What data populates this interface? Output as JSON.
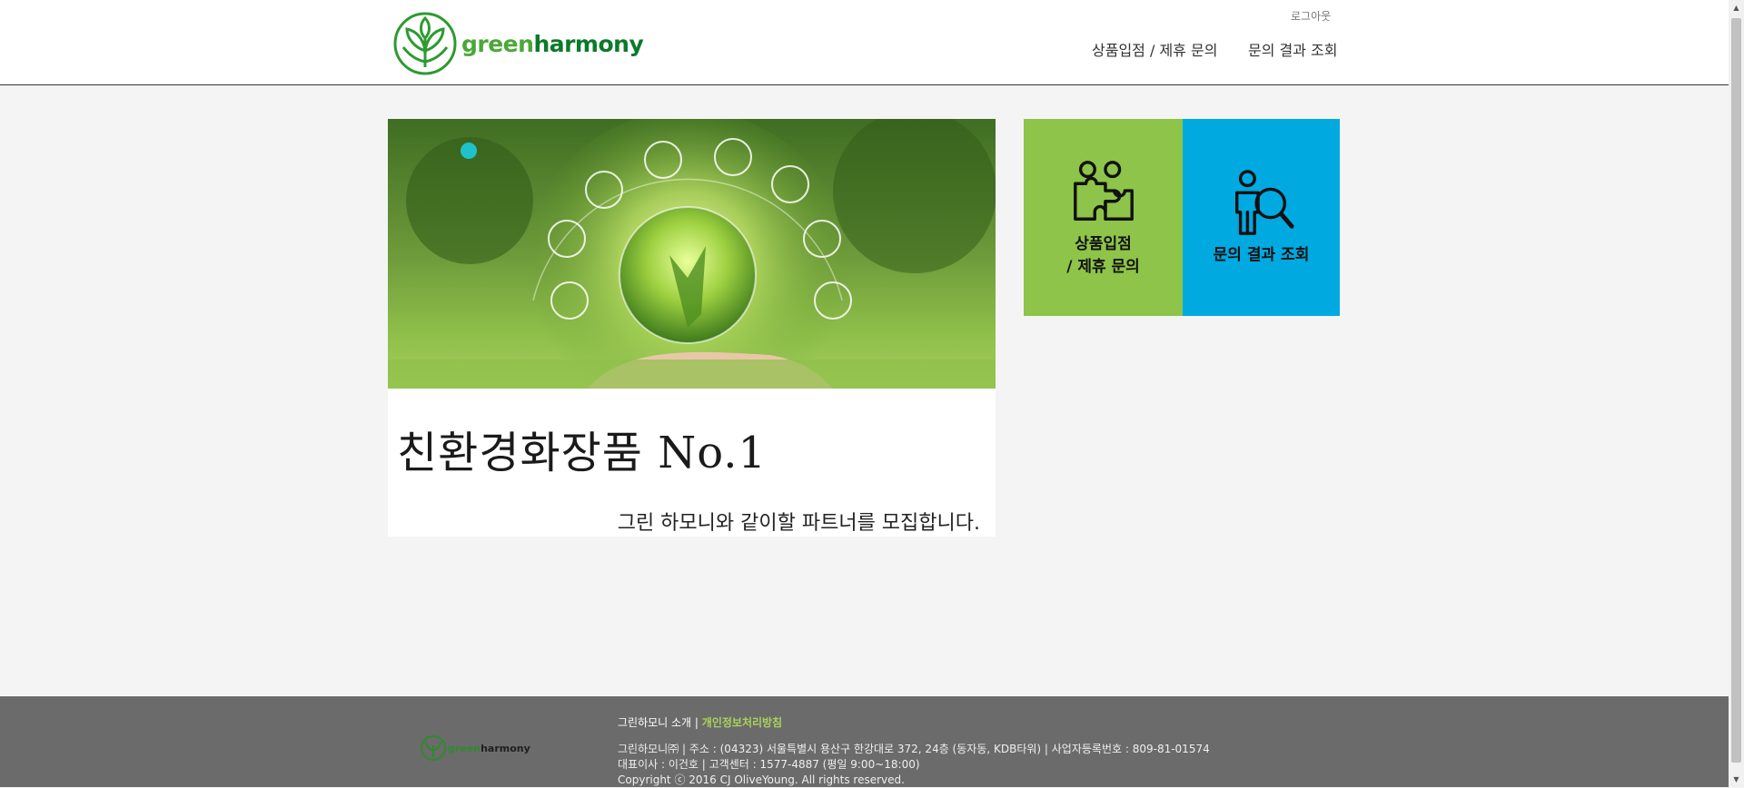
{
  "header": {
    "logo_text_light": "green",
    "logo_text_dark": "harmony",
    "logout": "로그아웃",
    "nav": [
      {
        "label": "상품입점 / 제휴 문의"
      },
      {
        "label": "문의 결과 조회"
      }
    ]
  },
  "banner": {
    "title": "친환경화장품  No.1",
    "subtitle": "그린 하모니와 같이할 파트너를 모집합니다."
  },
  "tiles": {
    "partner": {
      "line1": "상품입점",
      "line2": "/ 제휴 문의",
      "color": "#8dc449",
      "icon": "partnership-puzzle-icon"
    },
    "result": {
      "label": "문의 결과 조회",
      "color": "#00a9e0",
      "icon": "person-search-icon"
    }
  },
  "footer": {
    "logo_text_light": "green",
    "logo_text_dark": "harmony",
    "about": "그린하모니 소개",
    "separator": " | ",
    "privacy": "개인정보처리방침",
    "address": "그린하모니㈜ | 주소 : (04323) 서울특별시 용산구 한강대로 372, 24층 (동자동, KDB타워) | 사업자등록번호 : 809-81-01574",
    "contact": "대표이사 : 이건호 | 고객센터 : 1577-4887 (평일 9:00~18:00)",
    "copyright": "Copyright ⓒ 2016 CJ OliveYoung. All rights reserved."
  },
  "colors": {
    "brand_green": "#4aa838",
    "tile_green": "#8dc449",
    "tile_blue": "#00a9e0",
    "footer_bg": "#6b6b6b"
  }
}
